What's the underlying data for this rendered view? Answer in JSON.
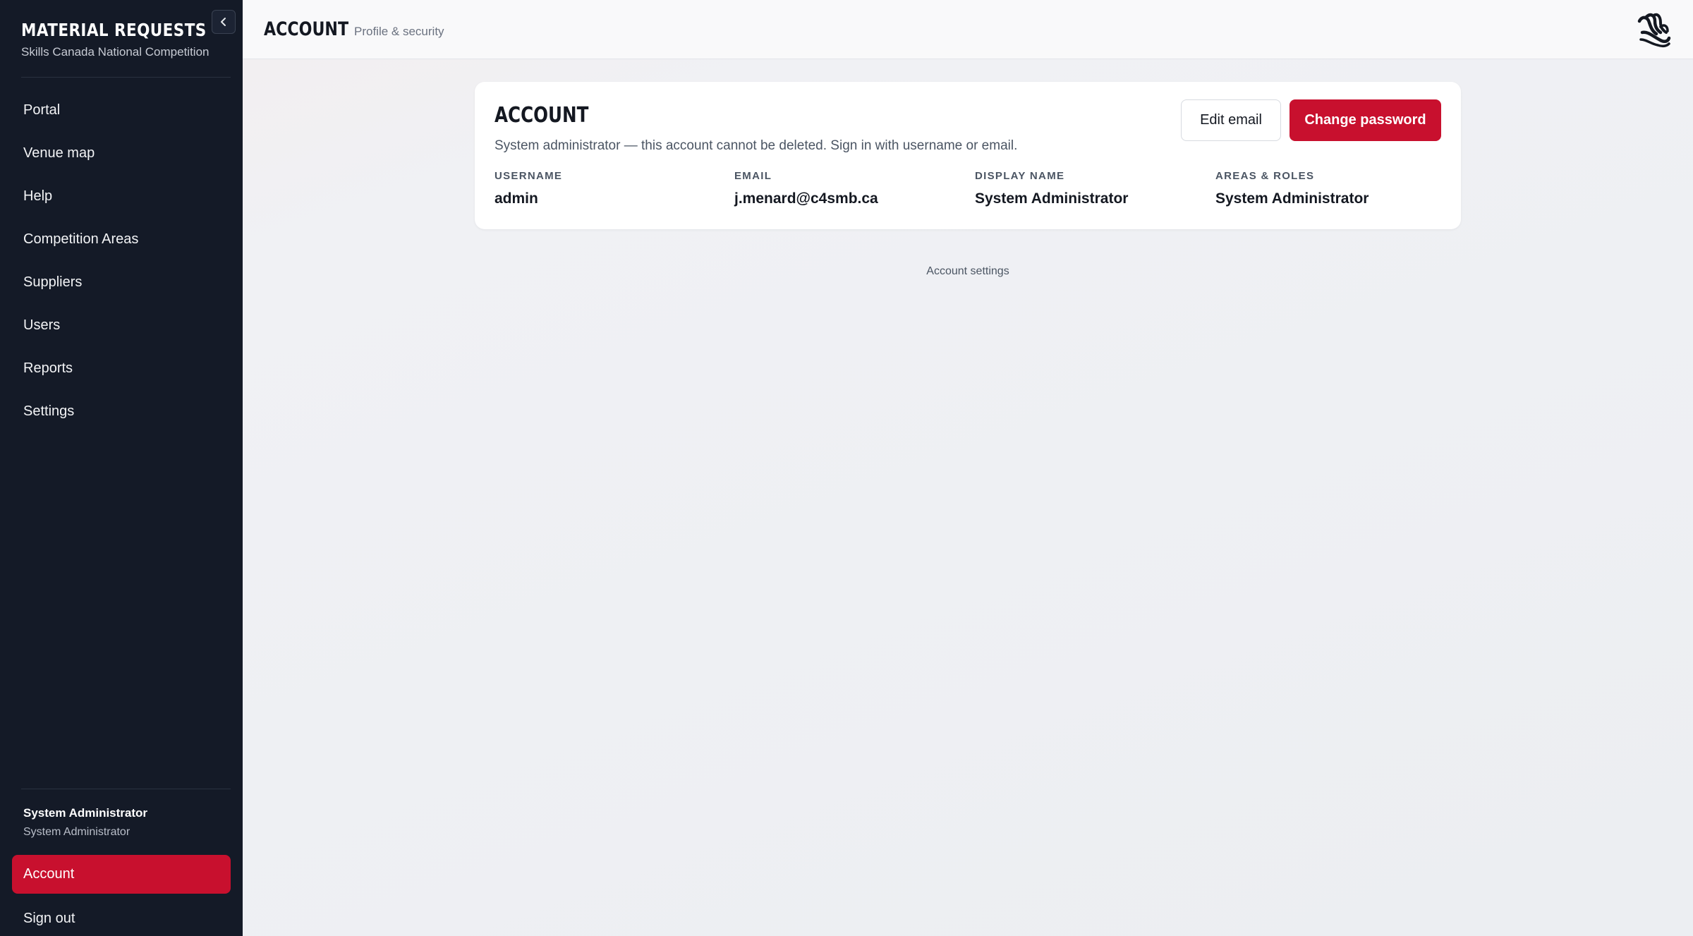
{
  "sidebar": {
    "brand_title": "MATERIAL REQUESTS",
    "brand_subtitle": "Skills Canada National Competition",
    "collapse_icon": "chevron-left-icon",
    "nav_items": [
      {
        "label": "Portal"
      },
      {
        "label": "Venue map"
      },
      {
        "label": "Help"
      },
      {
        "label": "Competition Areas"
      },
      {
        "label": "Suppliers"
      },
      {
        "label": "Users"
      },
      {
        "label": "Reports"
      },
      {
        "label": "Settings"
      }
    ],
    "user": {
      "name": "System Administrator",
      "role": "System Administrator"
    },
    "account_label": "Account",
    "signout_label": "Sign out"
  },
  "header": {
    "title": "ACCOUNT",
    "subtitle": "Profile & security",
    "logo_icon": "stylized-hand-logo"
  },
  "card": {
    "title": "ACCOUNT",
    "description": "System administrator — this account cannot be deleted. Sign in with username or email.",
    "edit_email_label": "Edit email",
    "change_password_label": "Change password",
    "fields": [
      {
        "label": "USERNAME",
        "value": "admin"
      },
      {
        "label": "EMAIL",
        "value": "j.menard@c4smb.ca"
      },
      {
        "label": "DISPLAY NAME",
        "value": "System Administrator"
      },
      {
        "label": "AREAS & ROLES",
        "value": "System Administrator"
      }
    ]
  },
  "footer_note": "Account settings",
  "colors": {
    "sidebar_bg": "#141a27",
    "accent": "#c8102e",
    "page_bg": "#eef0f4"
  }
}
